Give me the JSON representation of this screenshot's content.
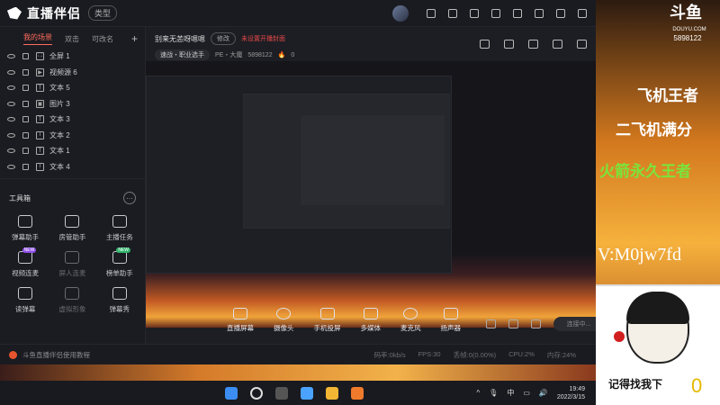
{
  "app": {
    "name": "直播伴侣",
    "version_badge": "类型"
  },
  "sidebar": {
    "tabs": [
      {
        "label": "我的场景",
        "active": true
      },
      {
        "label": "双击"
      },
      {
        "label": "可改名"
      }
    ],
    "sources": [
      {
        "label": "全屏 1"
      },
      {
        "label": "视频源 6"
      },
      {
        "label": "文本 5"
      },
      {
        "label": "图片 3"
      },
      {
        "label": "文本 3"
      },
      {
        "label": "文本 2"
      },
      {
        "label": "文本 1"
      },
      {
        "label": "文本 4"
      }
    ],
    "tools_title": "工具箱",
    "tools": [
      {
        "label": "弹幕助手"
      },
      {
        "label": "房管助手"
      },
      {
        "label": "主播任务"
      },
      {
        "label": "视频连麦",
        "tag": "NEW"
      },
      {
        "label": "屏人连麦",
        "dim": true
      },
      {
        "label": "榜单助手",
        "tag": "NEW"
      },
      {
        "label": "读弹幕"
      },
      {
        "label": "虚拟形象",
        "dim": true
      },
      {
        "label": "弹幕秀"
      }
    ]
  },
  "room": {
    "title": "别来无恙呀嗯嗯",
    "edit_label": "修改",
    "warning": "未设置开播封面",
    "category": "速战・职业选手",
    "level": "PE・大魔",
    "room_id": "5898122",
    "heat": "0"
  },
  "controls": [
    {
      "label": "直播屏幕"
    },
    {
      "label": "摄像头"
    },
    {
      "label": "手机投屏"
    },
    {
      "label": "多媒体"
    },
    {
      "label": "麦克风"
    },
    {
      "label": "扬声器"
    }
  ],
  "stream_button": "连接中...",
  "footer": {
    "tip": "斗鱼直播伴侣使用教程",
    "stats": [
      "码率:0kb/s",
      "FPS:30",
      "丢帧:0(0.00%)",
      "CPU:2%",
      "内存:24%"
    ]
  },
  "taskbar": {
    "lang": "中",
    "time": "19:49",
    "date": "2022/3/15"
  },
  "overlay": {
    "logo": "斗鱼",
    "small_text": "DOUYU.COM",
    "room_no": "5898122",
    "line1": "飞机王者",
    "line2": "二飞机满分",
    "line3": "火箭永久王者",
    "vline": "V:M0jw7fd",
    "meme_caption": "记得找我下",
    "meme_zero": "0"
  }
}
